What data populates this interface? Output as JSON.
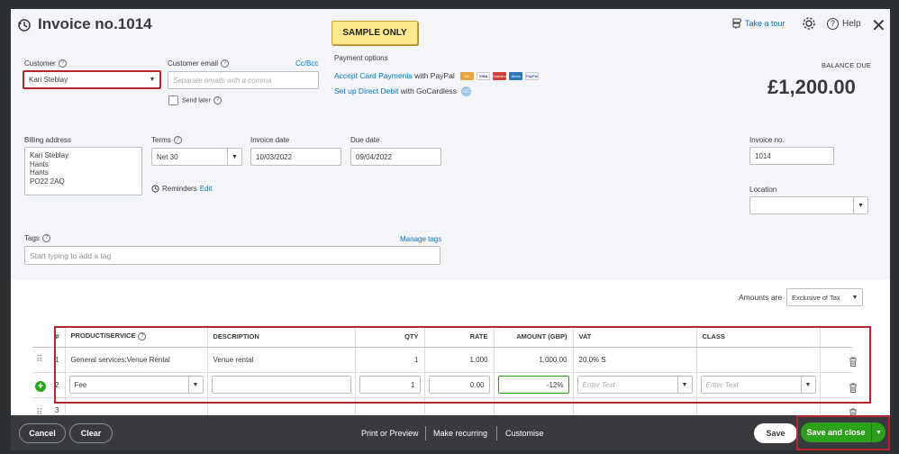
{
  "header": {
    "title": "Invoice no.1014",
    "take_tour": "Take a tour",
    "help": "Help",
    "sample_badge": "SAMPLE ONLY"
  },
  "customer": {
    "label": "Customer",
    "value": "Kari Steblay"
  },
  "customer_email": {
    "label": "Customer email",
    "placeholder": "Separate emails with a comma",
    "cc_bcc": "Cc/Bcc",
    "send_later": "Send later"
  },
  "payment_options": {
    "label": "Payment options",
    "accept_card_link": "Accept Card Payments",
    "accept_card_suffix": " with PayPal",
    "card_logos": [
      "MC",
      "VISA",
      "Maestro",
      "Amex",
      "PayPal"
    ],
    "direct_debit_link": "Set up Direct Debit",
    "direct_debit_suffix": " with GoCardless",
    "gocardless_icon": "GC"
  },
  "balance": {
    "label": "BALANCE DUE",
    "amount": "£1,200.00"
  },
  "billing": {
    "label": "Billing address",
    "lines": [
      "Kari Steblay",
      "Hants",
      "Hants",
      "PO22 2AQ"
    ]
  },
  "terms": {
    "label": "Terms",
    "value": "Net 30"
  },
  "invoice_date": {
    "label": "Invoice date",
    "value": "10/03/2022"
  },
  "due_date": {
    "label": "Due date",
    "value": "09/04/2022"
  },
  "reminders": {
    "label": "Reminders",
    "edit": "Edit"
  },
  "invoice_no": {
    "label": "Invoice no.",
    "value": "1014"
  },
  "location": {
    "label": "Location",
    "value": ""
  },
  "tags": {
    "label": "Tags",
    "manage": "Manage tags",
    "placeholder": "Start typing to add a tag"
  },
  "amounts_are": {
    "label": "Amounts are",
    "value": "Exclusive of Tax"
  },
  "table": {
    "headers": [
      "#",
      "PRODUCT/SERVICE",
      "DESCRIPTION",
      "QTY",
      "RATE",
      "AMOUNT (GBP)",
      "VAT",
      "CLASS"
    ],
    "rows": [
      {
        "num": "1",
        "product": "General services:Venue Rental",
        "description": "Venue rental",
        "qty": "1",
        "rate": "1,000",
        "amount": "1,000.00",
        "vat": "20.0% S",
        "class": ""
      },
      {
        "num": "2",
        "product": "Fee",
        "description": "",
        "qty": "1",
        "rate": "0.00",
        "amount": "-12%",
        "vat_placeholder": "Enter Text",
        "class_placeholder": "Enter Text"
      },
      {
        "num": "3"
      }
    ]
  },
  "footer": {
    "cancel": "Cancel",
    "clear": "Clear",
    "print_preview": "Print or Preview",
    "make_recurring": "Make recurring",
    "customise": "Customise",
    "save": "Save",
    "save_close": "Save and close"
  },
  "colors": {
    "accent_green": "#2ca01c",
    "link_blue": "#0077c5",
    "highlight_red": "#b5262d",
    "footer_dark": "#393a3d"
  }
}
